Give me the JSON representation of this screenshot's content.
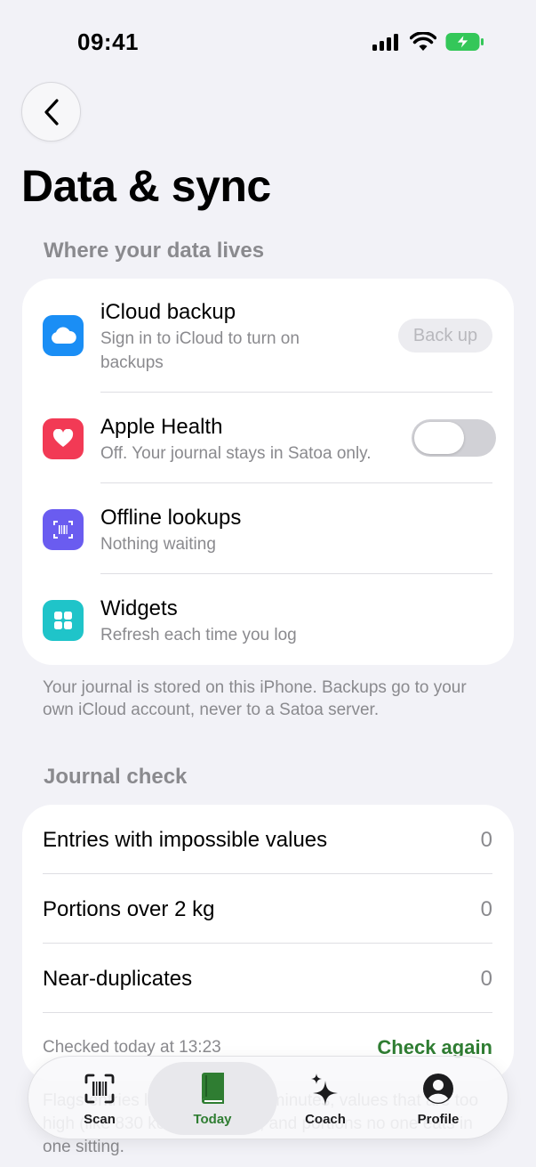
{
  "status_bar": {
    "time": "09:41"
  },
  "page": {
    "title": "Data & sync"
  },
  "data_section": {
    "header": "Where your data lives",
    "rows": [
      {
        "title": "iCloud backup",
        "subtitle": "Sign in to iCloud to turn on backups",
        "action": "Back up",
        "icon": "cloud-icon",
        "color": "#1a8ef5"
      },
      {
        "title": "Apple Health",
        "subtitle": "Off. Your journal stays in Satoa only.",
        "toggle_on": false,
        "icon": "heart-icon",
        "color": "#f23a55"
      },
      {
        "title": "Offline lookups",
        "subtitle": "Nothing waiting",
        "icon": "barcode-scan-icon",
        "color": "#6a5cf0"
      },
      {
        "title": "Widgets",
        "subtitle": "Refresh each time you log",
        "icon": "widgets-grid-icon",
        "color": "#1fc4c9"
      }
    ],
    "footnote": "Your journal is stored on this iPhone. Backups go to your own iCloud account, never to a Satoa server."
  },
  "journal_check": {
    "header": "Journal check",
    "rows": [
      {
        "label": "Entries with impossible values",
        "value": "0"
      },
      {
        "label": "Portions over 2 kg",
        "value": "0"
      },
      {
        "label": "Near-duplicates",
        "value": "0"
      }
    ],
    "checked_text": "Checked today at 13:23",
    "check_again": "Check again",
    "partial_footnote": "Flags entries logged within 10 minutes, values that are too high (like 830 kcal per 100 g), and portions no one eats in one sitting."
  },
  "tab_bar": {
    "tabs": [
      {
        "label": "Scan",
        "icon": "barcode-scan-icon",
        "active": false
      },
      {
        "label": "Today",
        "icon": "journal-book-icon",
        "active": true
      },
      {
        "label": "Coach",
        "icon": "sparkles-icon",
        "active": false
      },
      {
        "label": "Profile",
        "icon": "person-circle-icon",
        "active": false
      }
    ]
  },
  "colors": {
    "accent": "#2f7d32",
    "background": "#f2f2f7"
  }
}
